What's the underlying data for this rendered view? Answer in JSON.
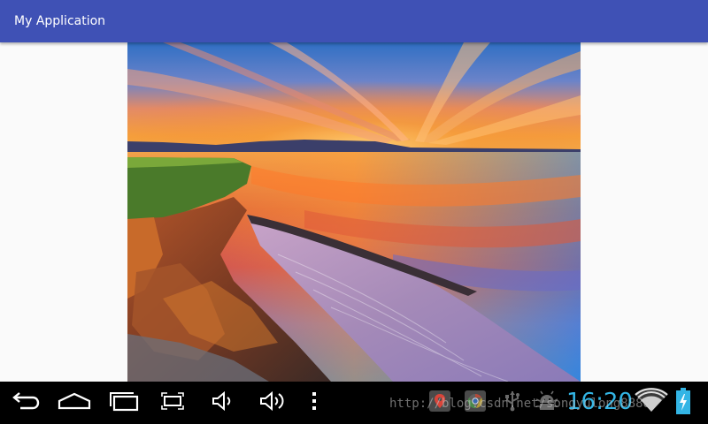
{
  "app_bar": {
    "title": "My Application",
    "background": "#3f51b5"
  },
  "main": {
    "image_icon": "sunset-landscape-image"
  },
  "navigation_bar": {
    "buttons": [
      {
        "name": "back",
        "icon": "back-arrow-icon"
      },
      {
        "name": "home",
        "icon": "home-icon"
      },
      {
        "name": "recent-apps",
        "icon": "recent-apps-icon"
      },
      {
        "name": "screenshot",
        "icon": "screenshot-icon"
      },
      {
        "name": "volume-down",
        "icon": "volume-down-icon"
      },
      {
        "name": "volume-up",
        "icon": "volume-up-icon"
      },
      {
        "name": "menu",
        "icon": "overflow-menu-icon"
      }
    ]
  },
  "status_bar": {
    "time": "16:20",
    "time_color": "#33b5e5",
    "notification_icons": [
      "maps-notification-icon",
      "chrome-notification-icon",
      "usb-icon",
      "android-debug-icon"
    ],
    "wifi_icon": "wifi-icon",
    "battery_icon": "battery-charging-icon",
    "battery_color": "#33b5e5"
  },
  "watermark": {
    "text": "http://blog.csdn.net/songyulong8888"
  }
}
